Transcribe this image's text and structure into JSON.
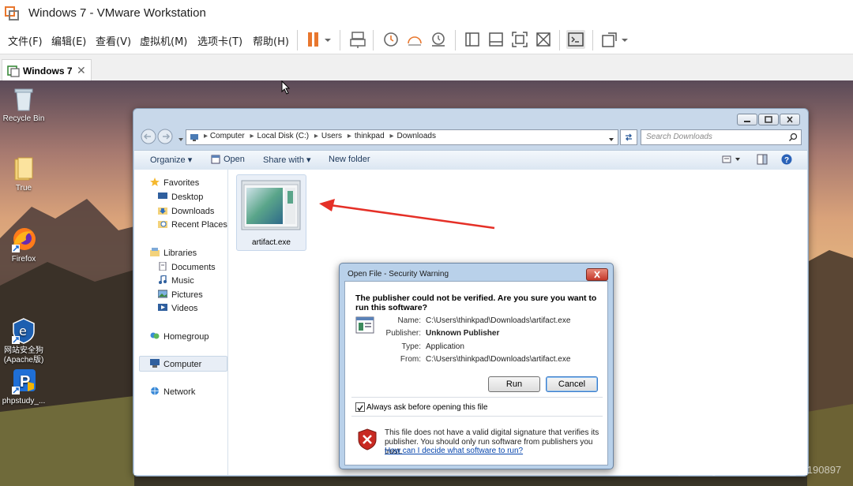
{
  "window": {
    "title": "Windows 7 - VMware Workstation"
  },
  "menu": {
    "items": [
      "文件(F)",
      "编辑(E)",
      "查看(V)",
      "虚拟机(M)",
      "选项卡(T)",
      "帮助(H)"
    ]
  },
  "tab": {
    "label": "Windows 7",
    "close": "✕"
  },
  "desktop": {
    "icons": [
      {
        "label": "Recycle Bin"
      },
      {
        "label": "True"
      },
      {
        "label": "Firefox"
      },
      {
        "label": "网站安全狗\n(Apache版)"
      },
      {
        "label": "phpstudy_..."
      }
    ]
  },
  "explorer": {
    "breadcrumb": [
      "Computer",
      "Local Disk (C:)",
      "Users",
      "thinkpad",
      "Downloads"
    ],
    "search_placeholder": "Search Downloads",
    "commands": {
      "organize": "Organize",
      "open": "Open",
      "share": "Share with",
      "newfolder": "New folder"
    },
    "nav": {
      "favorites": "Favorites",
      "desktop": "Desktop",
      "downloads": "Downloads",
      "recent": "Recent Places",
      "libraries": "Libraries",
      "documents": "Documents",
      "music": "Music",
      "pictures": "Pictures",
      "videos": "Videos",
      "homegroup": "Homegroup",
      "computer": "Computer",
      "network": "Network"
    },
    "file": {
      "name": "artifact.exe"
    }
  },
  "dialog": {
    "title": "Open File - Security Warning",
    "question": "The publisher could not be verified.  Are you sure you want to run this software?",
    "labels": {
      "name": "Name:",
      "publisher": "Publisher:",
      "type": "Type:",
      "from": "From:"
    },
    "values": {
      "name": "C:\\Users\\thinkpad\\Downloads\\artifact.exe",
      "publisher": "Unknown Publisher",
      "type": "Application",
      "from": "C:\\Users\\thinkpad\\Downloads\\artifact.exe"
    },
    "run": "Run",
    "cancel": "Cancel",
    "always_ask": "Always ask before opening this file",
    "warning": "This file does not have a valid digital signature that verifies its publisher.  You should only run software from publishers you trust.",
    "help_link": "How can I decide what software to run?"
  },
  "watermark": "https://blog.csdn.net/weixin_39190897",
  "colors": {
    "accent_orange": "#e8772e",
    "link_blue": "#0645ad",
    "arrow_red": "#e53027"
  }
}
